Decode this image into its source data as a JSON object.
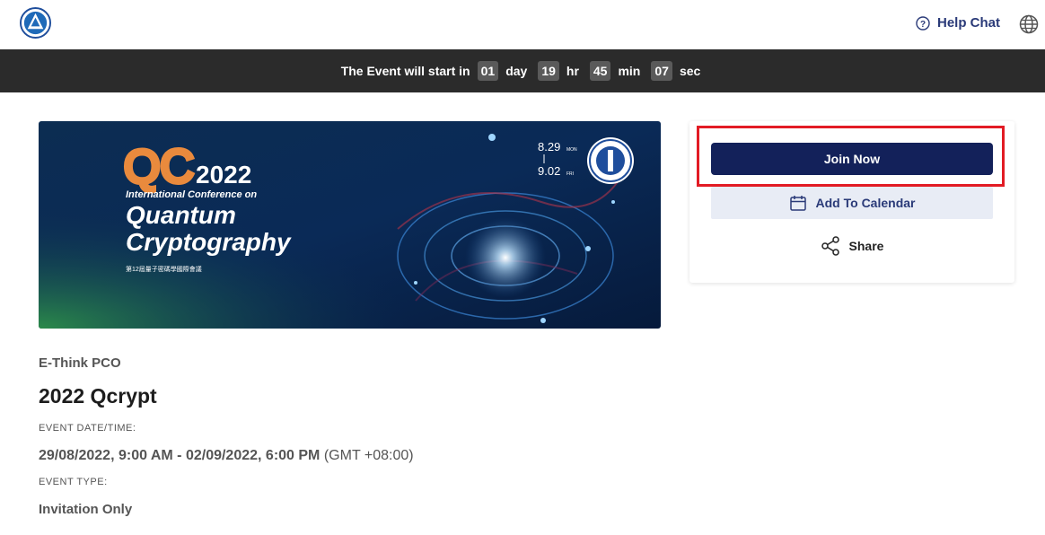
{
  "header": {
    "help_label": "Help Chat",
    "logo_icon": "organization-logo-icon",
    "help_icon": "question-circle-icon",
    "language_icon": "globe-icon"
  },
  "countdown": {
    "prefix": "The Event will start in",
    "days": "01",
    "days_unit": "day",
    "hours": "19",
    "hours_unit": "hr",
    "minutes": "45",
    "minutes_unit": "min",
    "seconds": "07",
    "seconds_unit": "sec"
  },
  "banner": {
    "logo_text": "QC",
    "year": "2022",
    "subtitle": "International Conference on",
    "line1": "Quantum",
    "line2": "Cryptography",
    "chinese": "第12屆量子密碼學國際會議",
    "date_start": "8.29",
    "date_start_day": "MON",
    "date_end": "9.02",
    "date_end_day": "FRI",
    "seal_icon": "academia-sinica-seal-icon"
  },
  "actions": {
    "join_label": "Join Now",
    "calendar_label": "Add To Calendar",
    "calendar_icon": "calendar-icon",
    "share_label": "Share",
    "share_icon": "share-icon",
    "highlight_color": "#e21b24",
    "primary_color": "#13215a"
  },
  "event": {
    "organizer": "E-Think PCO",
    "name": "2022 Qcrypt",
    "date_label": "EVENT DATE/TIME:",
    "date_value": "29/08/2022, 9:00 AM - 02/09/2022, 6:00 PM",
    "timezone": "(GMT +08:00)",
    "type_label": "EVENT TYPE:",
    "type_value": "Invitation Only"
  }
}
